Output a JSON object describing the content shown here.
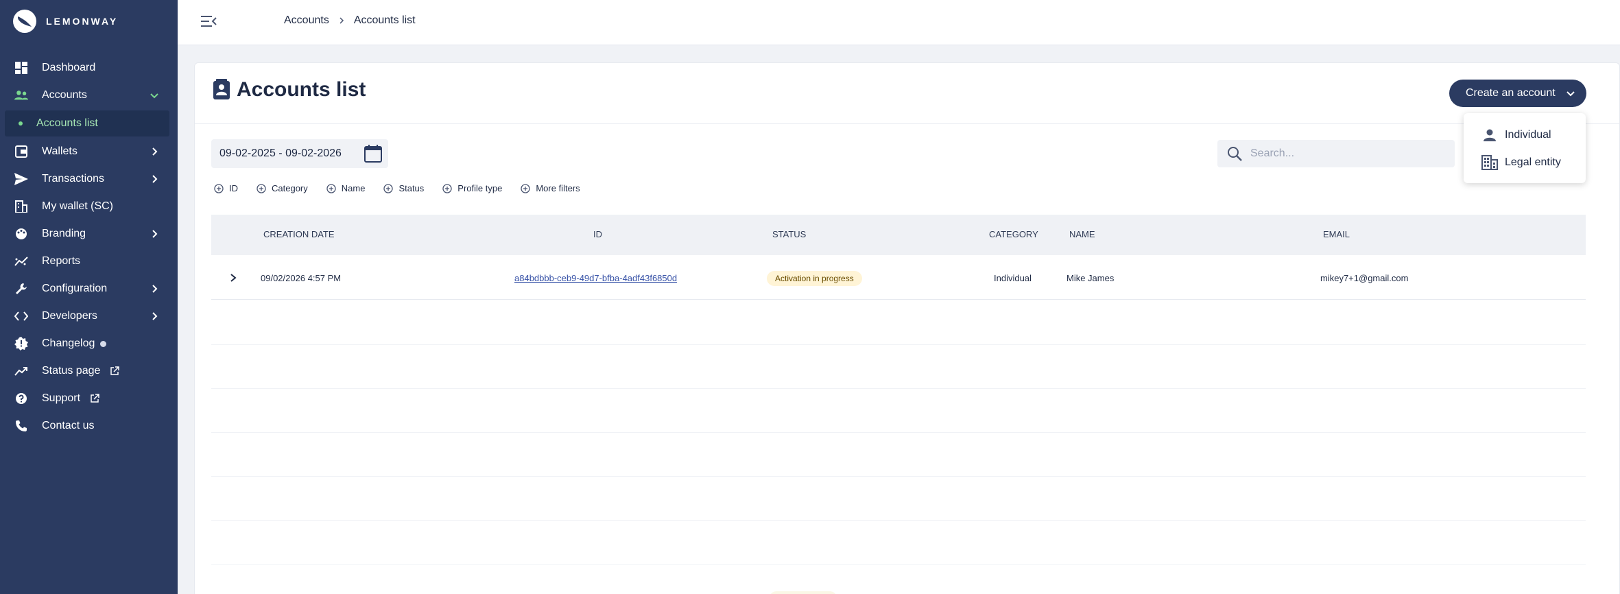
{
  "brand": {
    "name": "LEMONWAY"
  },
  "sidebar": {
    "items": [
      {
        "label": "Dashboard",
        "icon": "dashboard-icon"
      },
      {
        "label": "Accounts",
        "icon": "users-icon",
        "expanded": true
      },
      {
        "label": "Accounts list",
        "sub": true,
        "active": true
      },
      {
        "label": "Wallets",
        "icon": "wallet-icon"
      },
      {
        "label": "Transactions",
        "icon": "send-icon"
      },
      {
        "label": "My wallet (SC)",
        "icon": "building-icon"
      },
      {
        "label": "Branding",
        "icon": "palette-icon"
      },
      {
        "label": "Reports",
        "icon": "chart-icon"
      },
      {
        "label": "Configuration",
        "icon": "wrench-icon"
      },
      {
        "label": "Developers",
        "icon": "code-icon"
      },
      {
        "label": "Changelog",
        "icon": "badge-icon"
      },
      {
        "label": "Status page",
        "icon": "trend-icon"
      },
      {
        "label": "Support",
        "icon": "help-icon"
      },
      {
        "label": "Contact us",
        "icon": "phone-icon"
      }
    ]
  },
  "breadcrumb": {
    "first": "Accounts",
    "second": "Accounts list"
  },
  "page": {
    "title": "Accounts list"
  },
  "create_button": {
    "label": "Create an account"
  },
  "dropdown": {
    "individual": "Individual",
    "legal": "Legal entity"
  },
  "date_range": {
    "value": "09-02-2025 - 09-02-2026"
  },
  "search": {
    "placeholder": "Search..."
  },
  "filters": [
    "ID",
    "Category",
    "Name",
    "Status",
    "Profile type",
    "More filters"
  ],
  "table": {
    "headers": [
      "CREATION DATE",
      "ID",
      "STATUS",
      "CATEGORY",
      "NAME",
      "EMAIL"
    ],
    "rows": [
      {
        "date": "09/02/2026 4:57 PM",
        "id": "a84bdbbb-ceb9-49d7-bfba-4adf43f6850d",
        "status": "Activation in progress",
        "category": "Individual",
        "name": "Mike James",
        "email": "mikey7+1@gmail.com"
      }
    ]
  },
  "colors": {
    "sidebar": "#2b3b61",
    "accent_green": "#7bd88f",
    "badge_bg": "#fff4d6"
  }
}
